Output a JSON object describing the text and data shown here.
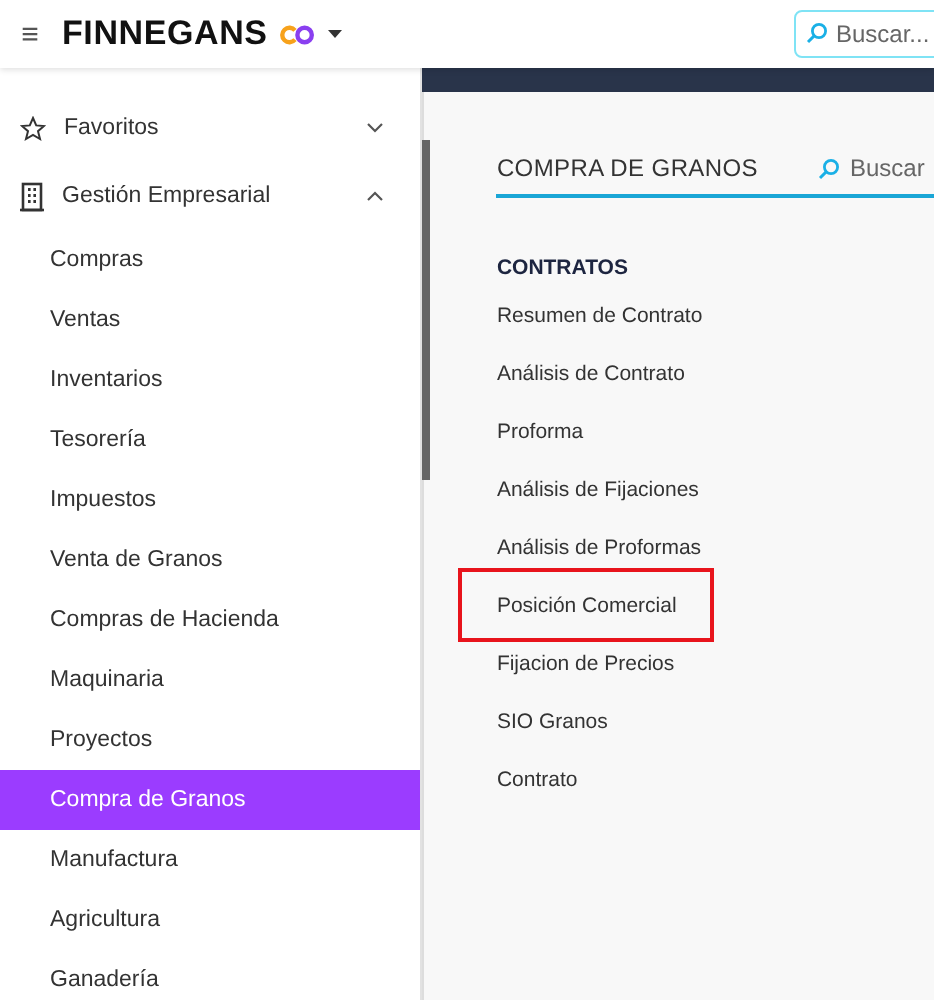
{
  "header": {
    "menu_icon": "≡",
    "brand": "FINNEGANS",
    "search": {
      "placeholder": "Buscar..."
    }
  },
  "sidebar": {
    "sections": [
      {
        "label": "Favoritos",
        "expanded": false
      },
      {
        "label": "Gestión Empresarial",
        "expanded": true
      }
    ],
    "items": [
      {
        "label": "Compras",
        "selected": false
      },
      {
        "label": "Ventas",
        "selected": false
      },
      {
        "label": "Inventarios",
        "selected": false
      },
      {
        "label": "Tesorería",
        "selected": false
      },
      {
        "label": "Impuestos",
        "selected": false
      },
      {
        "label": "Venta de Granos",
        "selected": false
      },
      {
        "label": "Compras de Hacienda",
        "selected": false
      },
      {
        "label": "Maquinaria",
        "selected": false
      },
      {
        "label": "Proyectos",
        "selected": false
      },
      {
        "label": "Compra de Granos",
        "selected": true
      },
      {
        "label": "Manufactura",
        "selected": false
      },
      {
        "label": "Agricultura",
        "selected": false
      },
      {
        "label": "Ganadería",
        "selected": false
      }
    ]
  },
  "panel": {
    "title": "COMPRA DE GRANOS",
    "search": {
      "placeholder": "Buscar"
    },
    "group": "CONTRATOS",
    "links": [
      {
        "label": "Resumen de Contrato",
        "highlighted": false
      },
      {
        "label": "Análisis de Contrato",
        "highlighted": false
      },
      {
        "label": "Proforma",
        "highlighted": false
      },
      {
        "label": "Análisis de Fijaciones",
        "highlighted": false
      },
      {
        "label": "Análisis de Proformas",
        "highlighted": false
      },
      {
        "label": "Posición Comercial",
        "highlighted": true
      },
      {
        "label": "Fijacion de Precios",
        "highlighted": false
      },
      {
        "label": "SIO Granos",
        "highlighted": false
      },
      {
        "label": "Contrato",
        "highlighted": false
      }
    ]
  }
}
